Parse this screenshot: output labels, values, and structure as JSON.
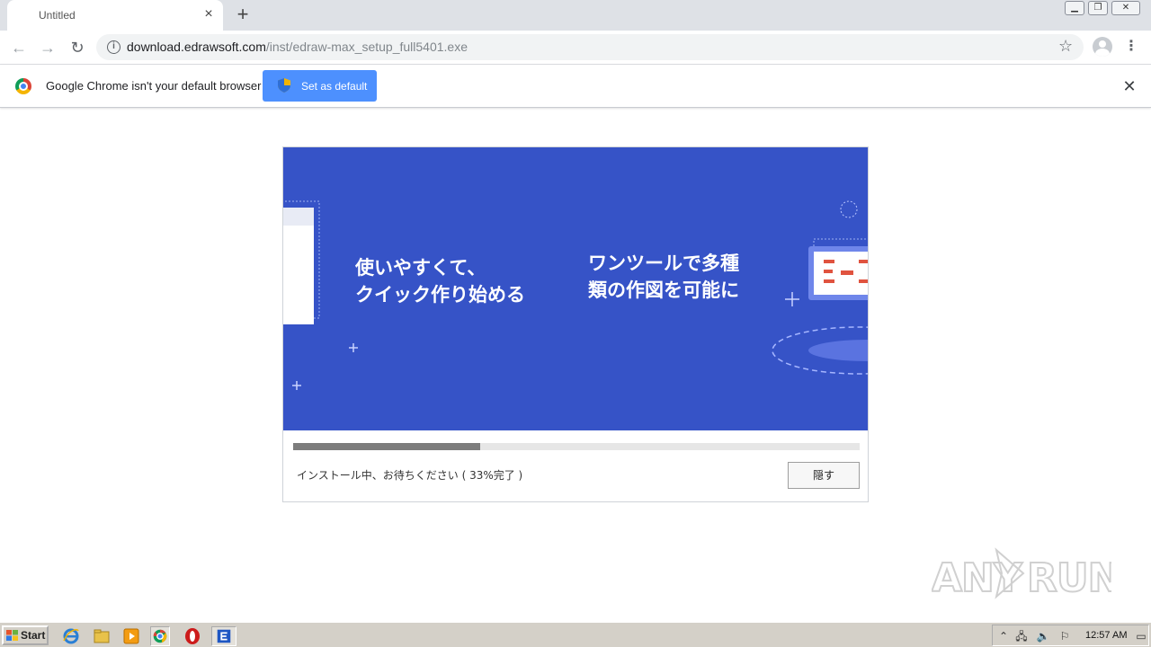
{
  "browser": {
    "tab": {
      "title": "Untitled"
    },
    "address": {
      "host": "download.edrawsoft.com",
      "path": "/inst/edraw-max_setup_full5401.exe"
    }
  },
  "infobar": {
    "message": "Google Chrome isn't your default browser",
    "button_label": "Set as default"
  },
  "installer": {
    "banner": {
      "left_line1": "使いやすくて、",
      "left_line2": "クイック作り始める",
      "right_line1": "ワンツールで多種",
      "right_line2": "類の作図を可能に"
    },
    "progress_percent": 33,
    "status": "インストール中、お待ちください ( 33%完了 )",
    "hide_button": "隠す"
  },
  "watermark": {
    "text": "ANY RUN"
  },
  "taskbar": {
    "start_label": "Start",
    "clock": "12:57 AM"
  },
  "colors": {
    "banner_blue": "#3653c7",
    "button_blue": "#4d90fe",
    "progress_fill": "#7d7d7d"
  }
}
